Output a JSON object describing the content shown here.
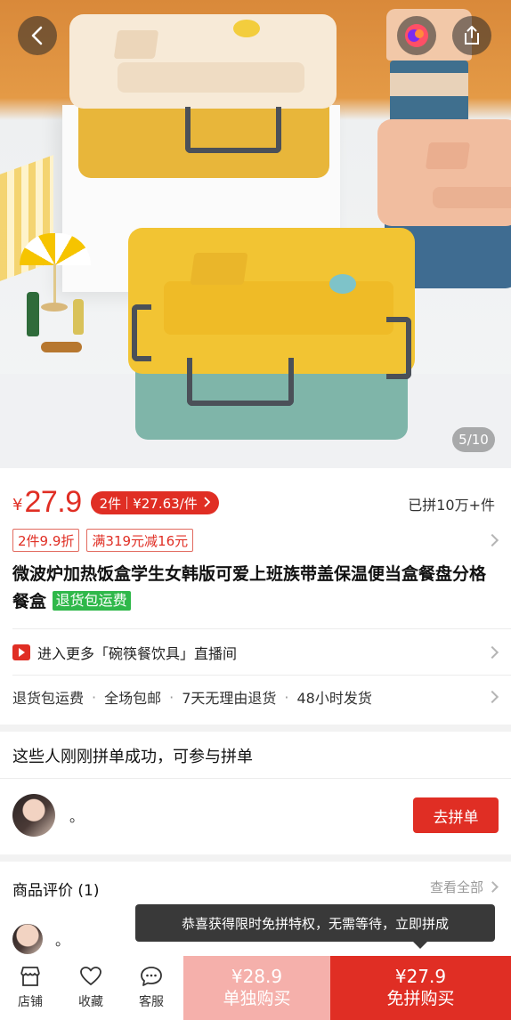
{
  "gallery": {
    "counter": "5/10"
  },
  "price": {
    "currency": "¥",
    "value": "27.9",
    "multi_qty": "2件",
    "multi_price": "¥27.63/件",
    "sold": "已拼10万+件"
  },
  "promos": [
    "2件9.9折",
    "满319元减16元"
  ],
  "product": {
    "title": "微波炉加热饭盒学生女韩版可爱上班族带盖保温便当盒餐盘分格餐盒",
    "tag": "退货包运费"
  },
  "live": {
    "text": "进入更多「碗筷餐饮具」直播间"
  },
  "services": [
    "退货包运费",
    "全场包邮",
    "7天无理由退货",
    "48小时发货"
  ],
  "service_separator": "·",
  "group_buy": {
    "heading": "这些人刚刚拼单成功，可参与拼单",
    "user_name": "。",
    "join_label": "去拼单"
  },
  "reviews": {
    "heading": "商品评价 (1)",
    "see_all": "查看全部",
    "user_name": "。"
  },
  "toast": "恭喜获得限时免拼特权，无需等待，立即拼成",
  "bottom_nav": [
    {
      "label": "店铺",
      "icon": "store-icon"
    },
    {
      "label": "收藏",
      "icon": "heart-icon"
    },
    {
      "label": "客服",
      "icon": "chat-icon"
    }
  ],
  "buy_alone": {
    "price": "¥28.9",
    "label": "单独购买"
  },
  "buy_group": {
    "price": "¥27.9",
    "label": "免拼购买"
  },
  "colors": {
    "accent": "#e02e24",
    "accent_light": "#f5b0ab",
    "tag_green": "#2fb84a"
  }
}
